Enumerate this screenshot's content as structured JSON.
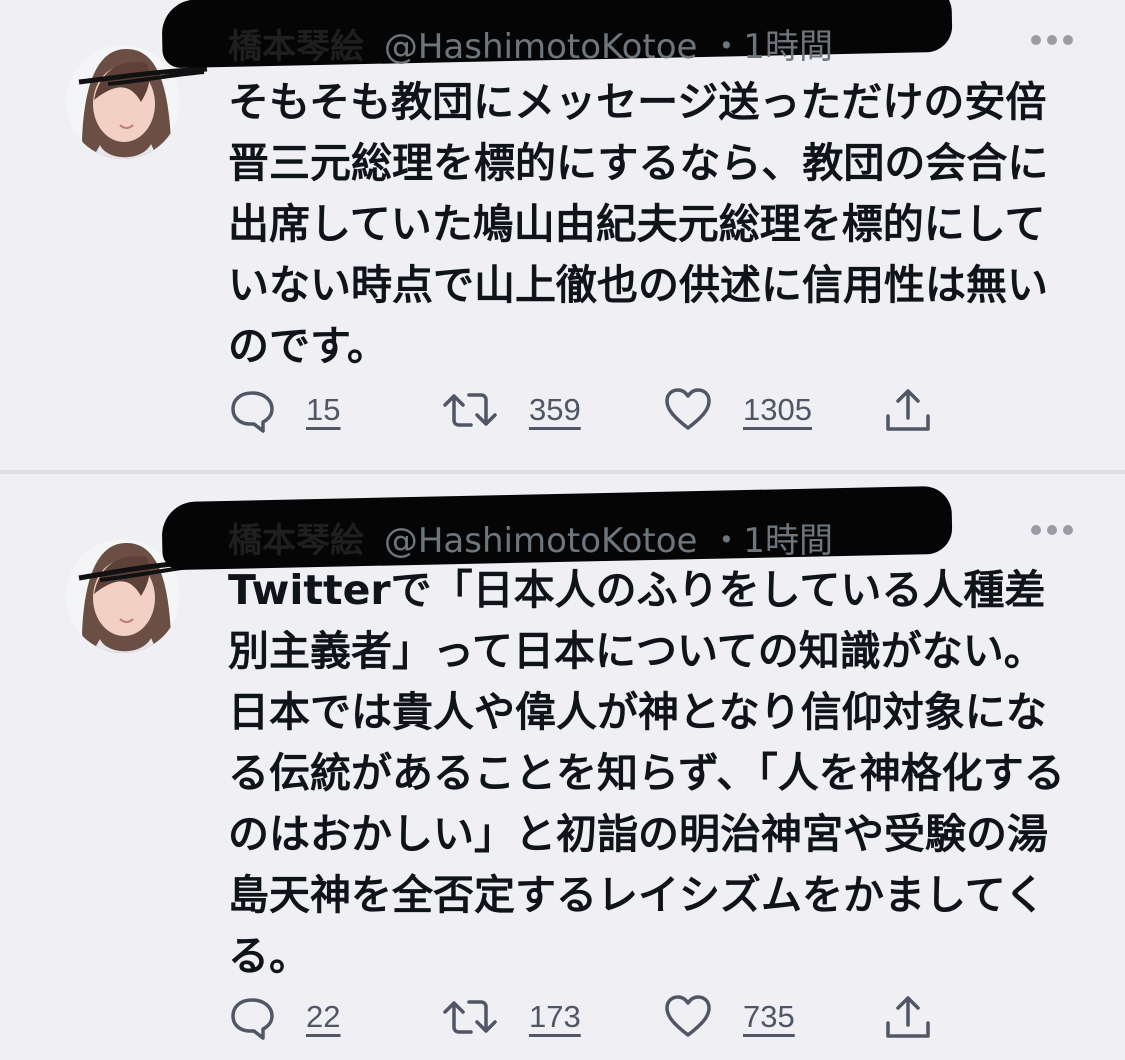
{
  "tweets": [
    {
      "name": "橋本琴絵",
      "handle": "@HashimotoKotoe",
      "time": "・1時間",
      "text": "そもそも教団にメッセージ送っただけの安倍晋三元総理を標的にするなら、教団の会合に出席していた鳩山由紀夫元総理を標的にしていない時点で山上徹也の供述に信用性は無いのです。",
      "replies": "15",
      "retweets": "359",
      "likes": "1305"
    },
    {
      "name": "橋本琴絵",
      "handle": "@HashimotoKotoe",
      "time": "・1時間",
      "text": "Twitterで「日本人のふりをしている人種差別主義者」って日本についての知識がない。日本では貴人や偉人が神となり信仰対象になる伝統があることを知らず、「人を神格化するのはおかしい」と初詣の明治神宮や受験の湯島天神を全否定するレイシズムをかましてくる。",
      "replies": "22",
      "retweets": "173",
      "likes": "735"
    }
  ],
  "icons": {
    "reply": "reply-icon",
    "retweet": "retweet-icon",
    "like": "heart-icon",
    "share": "share-icon",
    "more": "more-icon"
  },
  "colors": {
    "background": "#efeff4",
    "text": "#0f1419",
    "muted": "#6e767d",
    "action": "#4f5665"
  }
}
